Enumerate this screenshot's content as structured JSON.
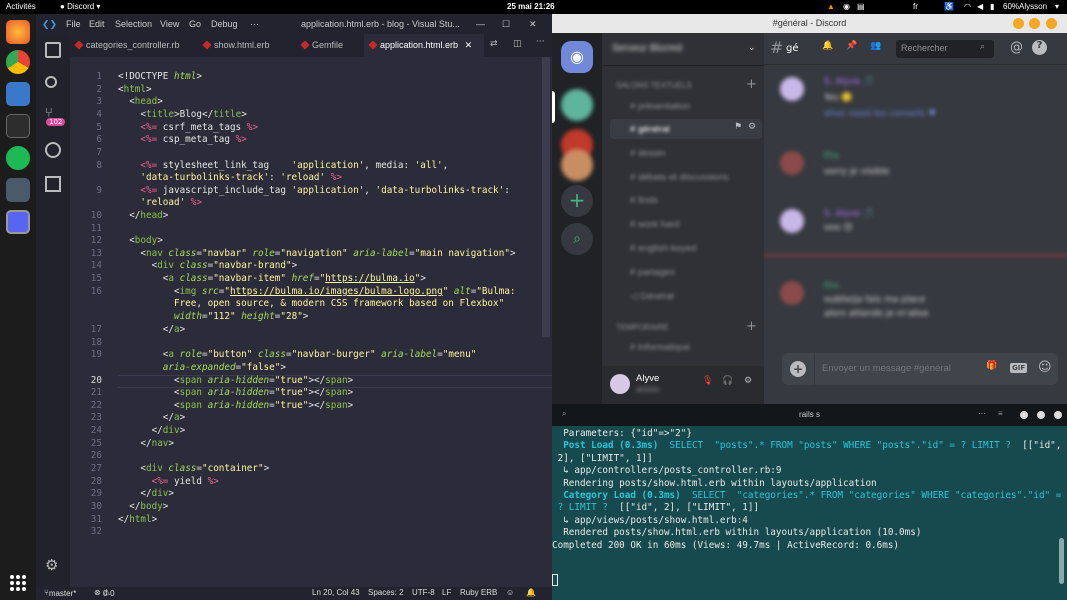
{
  "topbar": {
    "activities": "Activités",
    "app": "Discord",
    "clock": "25 mai 21:26",
    "lang": "fr",
    "battery": "60%",
    "user": "Alysson"
  },
  "vscode": {
    "menu": [
      "File",
      "Edit",
      "Selection",
      "View",
      "Go",
      "Debug",
      "···"
    ],
    "window_title": "application.html.erb - blog - Visual Stu...",
    "badge": "102",
    "tabs": [
      "categories_controller.rb",
      "show.html.erb",
      "Gemfile",
      "application.html.erb"
    ],
    "line_numbers": [
      "1",
      "2",
      "3",
      "4",
      "5",
      "6",
      "7",
      "8",
      "",
      "9",
      "",
      "10",
      "11",
      "12",
      "13",
      "14",
      "15",
      "16",
      "",
      "",
      "17",
      "18",
      "19",
      "",
      "20",
      "21",
      "22",
      "23",
      "24",
      "25",
      "26",
      "27",
      "28",
      "29",
      "30",
      "31",
      "32"
    ],
    "status": {
      "branch": "master*",
      "problems": "0",
      "warnings": "0",
      "position": "Ln 20, Col 43",
      "spaces": "Spaces: 2",
      "encoding": "UTF-8",
      "eol": "LF",
      "language": "Ruby ERB"
    }
  },
  "discord": {
    "title": "#général - Discord",
    "channel_header": "gé",
    "search_placeholder": "Rechercher",
    "server_name": "Serveur Blurred",
    "category1": "SALONS TEXTUELS",
    "channels": [
      "présentation",
      "général",
      "dessin",
      "débats et discussions",
      "finds",
      "work hard",
      "english-keyed",
      "partages",
      "Général"
    ],
    "category2": "TEMPORAIRE",
    "channel_extra": "informatique",
    "user_name": "Alyve",
    "user_tag": "#0000",
    "message_placeholder": "Envoyer un message #général",
    "messages": [
      {
        "author": "S. Alyve 🎵",
        "text": "Yes 🙂",
        "text2": "alive need les conseils ♥"
      },
      {
        "author": "Eta",
        "text": "sorry je visible"
      },
      {
        "author": "S. Alyve 🎵",
        "text": "ooo 😊"
      },
      {
        "author": "Eta",
        "text": "oublie/ja fais ma place",
        "text2": "alors attends je m'alise"
      }
    ]
  },
  "terminal": {
    "title": "rails s",
    "lines": [
      {
        "t": "  Parameters: {\"id\"=>\"2\"}"
      },
      {
        "t": "  Post Load (0.3ms)  SELECT  \"posts\".* FROM \"posts\" WHERE \"posts\".\"id\" = ? LIMIT ?  [[\"id\",",
        "c": "cy"
      },
      {
        "t": " 2], [\"LIMIT\", 1]]"
      },
      {
        "t": "  ↳ app/controllers/posts_controller.rb:9"
      },
      {
        "t": "  Rendering posts/show.html.erb within layouts/application"
      },
      {
        "t": "  Category Load (0.3ms)  SELECT  \"categories\".* FROM \"categories\" WHERE \"categories\".\"id\" =",
        "c": "cy"
      },
      {
        "t": " ? LIMIT ?  [[\"id\", 2], [\"LIMIT\", 1]]",
        "c": "mix"
      },
      {
        "t": "  ↳ app/views/posts/show.html.erb:4"
      },
      {
        "t": "  Rendered posts/show.html.erb within layouts/application (10.0ms)"
      },
      {
        "t": "Completed 200 OK in 60ms (Views: 49.7ms | ActiveRecord: 0.6ms)"
      }
    ]
  },
  "colors": {
    "erb_tag": "#f06292",
    "html_tag": "#8bc34a",
    "string": "#fff59d",
    "discord_blurple": "#7289da",
    "terminal_bg": "#174a4e"
  }
}
